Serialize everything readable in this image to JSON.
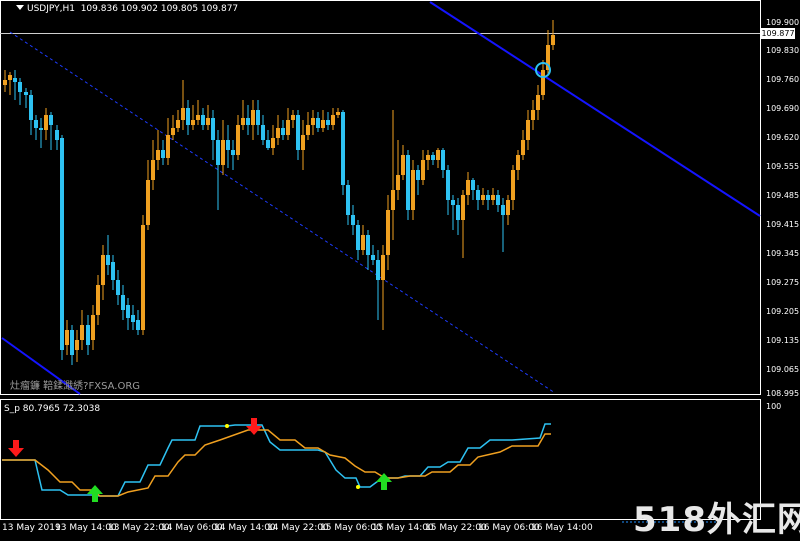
{
  "header": {
    "symbol": "USDJPY,H1",
    "ohlc": "109.836 109.902 109.805 109.877"
  },
  "indicator": {
    "label": "S_p 80.7965 72.3038",
    "scale_max": "100",
    "line1_color": "#2ec2f2",
    "line2_color": "#f0a020"
  },
  "watermark": "灶瘤鐮 鞛鍒濈綉?FXSA.ORG",
  "brand": "518外汇网",
  "current_price": "109.877",
  "price_scale": [
    "109.900",
    "109.830",
    "109.760",
    "109.690",
    "109.620",
    "109.555",
    "109.485",
    "109.415",
    "109.345",
    "109.275",
    "109.205",
    "109.135",
    "109.065",
    "108.995"
  ],
  "time_axis": [
    "13 May 2019",
    "13 May 14:00",
    "13 May 22:00",
    "14 May 06:00",
    "14 May 14:00",
    "14 May 22:00",
    "15 May 06:00",
    "15 May 14:00",
    "15 May 22:00",
    "16 May 06:00",
    "16 May 14:00"
  ],
  "colors": {
    "background": "#000000",
    "bull_candle": "#f0a020",
    "bear_candle": "#2ec2f2",
    "channel": "#1414ff",
    "grid_text": "#ffffff",
    "sell_arrow": "#ff1a1a",
    "buy_arrow": "#22dd22",
    "marker_dot": "#ffff00"
  },
  "icons": {
    "sell_signal": "down-arrow-icon",
    "buy_signal": "up-arrow-icon",
    "touch_marker": "circle-marker-icon"
  }
}
